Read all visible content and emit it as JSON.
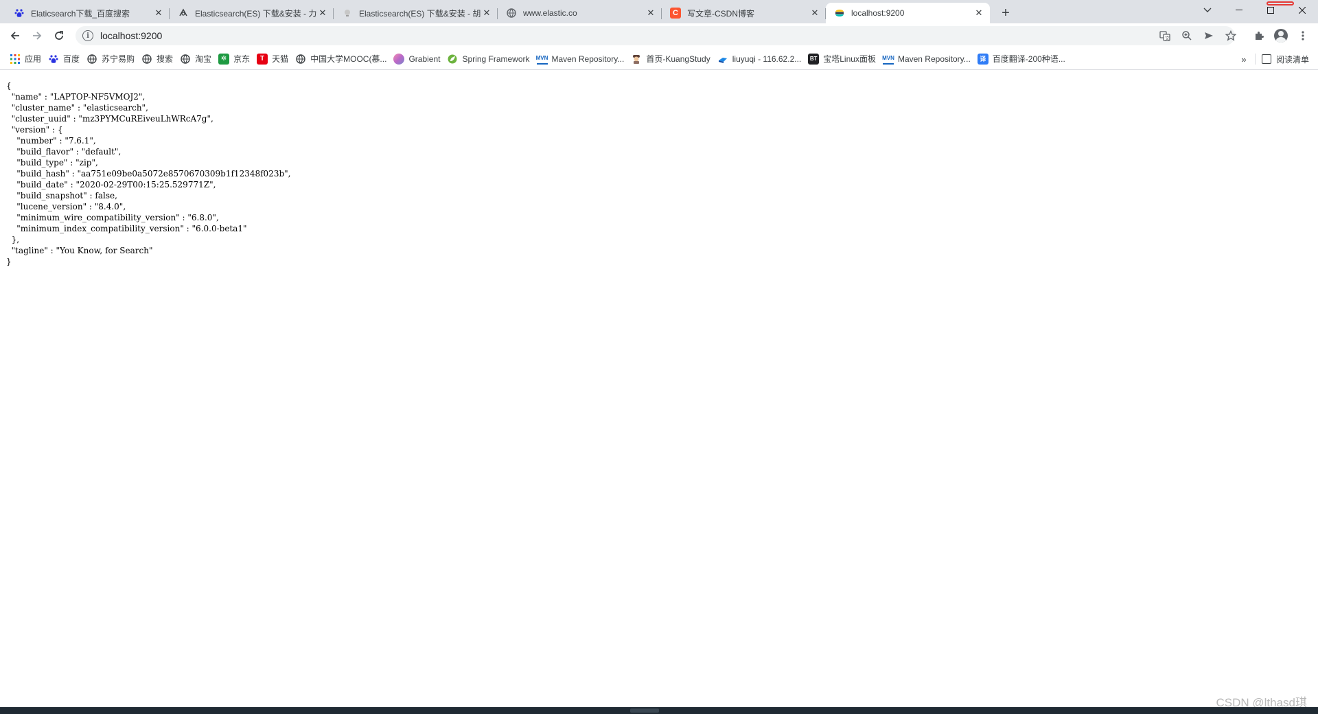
{
  "tabs": [
    {
      "title": "Elaticsearch下载_百度搜索",
      "icon": "baidu-paw-icon",
      "active": false
    },
    {
      "title": "Elasticsearch(ES) 下载&安装 - 力",
      "icon": "yuque-bird-icon",
      "active": false
    },
    {
      "title": "Elasticsearch(ES) 下载&安装 - 胡",
      "icon": "yuque-light-icon",
      "active": false
    },
    {
      "title": "www.elastic.co",
      "icon": "globe-icon",
      "active": false
    },
    {
      "title": "写文章-CSDN博客",
      "icon": "csdn-c-icon",
      "active": false
    },
    {
      "title": "localhost:9200",
      "icon": "elastic-icon",
      "active": true
    }
  ],
  "address": {
    "url": "localhost:9200"
  },
  "bookmarks": [
    {
      "label": "应用",
      "icon": "apps-grid-icon"
    },
    {
      "label": "百度",
      "icon": "baidu-paw-icon"
    },
    {
      "label": "苏宁易购",
      "icon": "globe-icon"
    },
    {
      "label": "搜索",
      "icon": "globe-icon"
    },
    {
      "label": "淘宝",
      "icon": "globe-icon"
    },
    {
      "label": "京东",
      "icon": "jd-icon"
    },
    {
      "label": "天猫",
      "icon": "tmall-icon"
    },
    {
      "label": "中国大学MOOC(慕...",
      "icon": "globe-icon"
    },
    {
      "label": "Grabient",
      "icon": "grabient-icon"
    },
    {
      "label": "Spring Framework",
      "icon": "spring-leaf-icon"
    },
    {
      "label": "Maven Repository...",
      "icon": "maven-icon"
    },
    {
      "label": "首页-KuangStudy",
      "icon": "kuang-avatar-icon"
    },
    {
      "label": "liuyuqi - 116.62.2...",
      "icon": "server-icon"
    },
    {
      "label": "宝塔Linux面板",
      "icon": "bt-icon"
    },
    {
      "label": "Maven Repository...",
      "icon": "maven-icon"
    },
    {
      "label": "百度翻译-200种语...",
      "icon": "baidu-translate-icon"
    }
  ],
  "bookmarks_more": "»",
  "reading_list": {
    "label": "阅读清单"
  },
  "response": {
    "lines": [
      "{",
      "  \"name\" : \"LAPTOP-NF5VMOJ2\",",
      "  \"cluster_name\" : \"elasticsearch\",",
      "  \"cluster_uuid\" : \"mz3PYMCuREiveuLhWRcA7g\",",
      "  \"version\" : {",
      "    \"number\" : \"7.6.1\",",
      "    \"build_flavor\" : \"default\",",
      "    \"build_type\" : \"zip\",",
      "    \"build_hash\" : \"aa751e09be0a5072e8570670309b1f12348f023b\",",
      "    \"build_date\" : \"2020-02-29T00:15:25.529771Z\",",
      "    \"build_snapshot\" : false,",
      "    \"lucene_version\" : \"8.4.0\",",
      "    \"minimum_wire_compatibility_version\" : \"6.8.0\",",
      "    \"minimum_index_compatibility_version\" : \"6.0.0-beta1\"",
      "  },",
      "  \"tagline\" : \"You Know, for Search\"",
      "}"
    ]
  },
  "watermark": "CSDN @lthasd琪"
}
